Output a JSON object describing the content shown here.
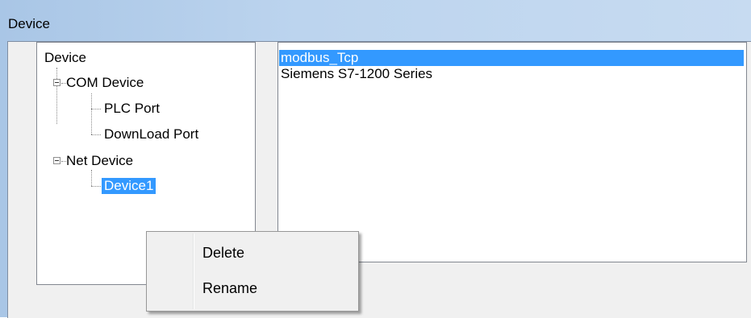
{
  "window": {
    "title": "Device"
  },
  "tree": {
    "root": "Device",
    "nodes": [
      {
        "label": "COM Device",
        "children": [
          "PLC Port",
          "DownLoad Port"
        ]
      },
      {
        "label": "Net Device",
        "children": [
          "Device1"
        ]
      }
    ]
  },
  "list": {
    "items": [
      "modbus_Tcp",
      "Siemens S7-1200 Series"
    ],
    "selected_index": 0
  },
  "context_menu": {
    "items": [
      "Delete",
      "Rename"
    ]
  },
  "colors": {
    "selection": "#3399ff",
    "title_gradient": "#a9c6e6"
  }
}
